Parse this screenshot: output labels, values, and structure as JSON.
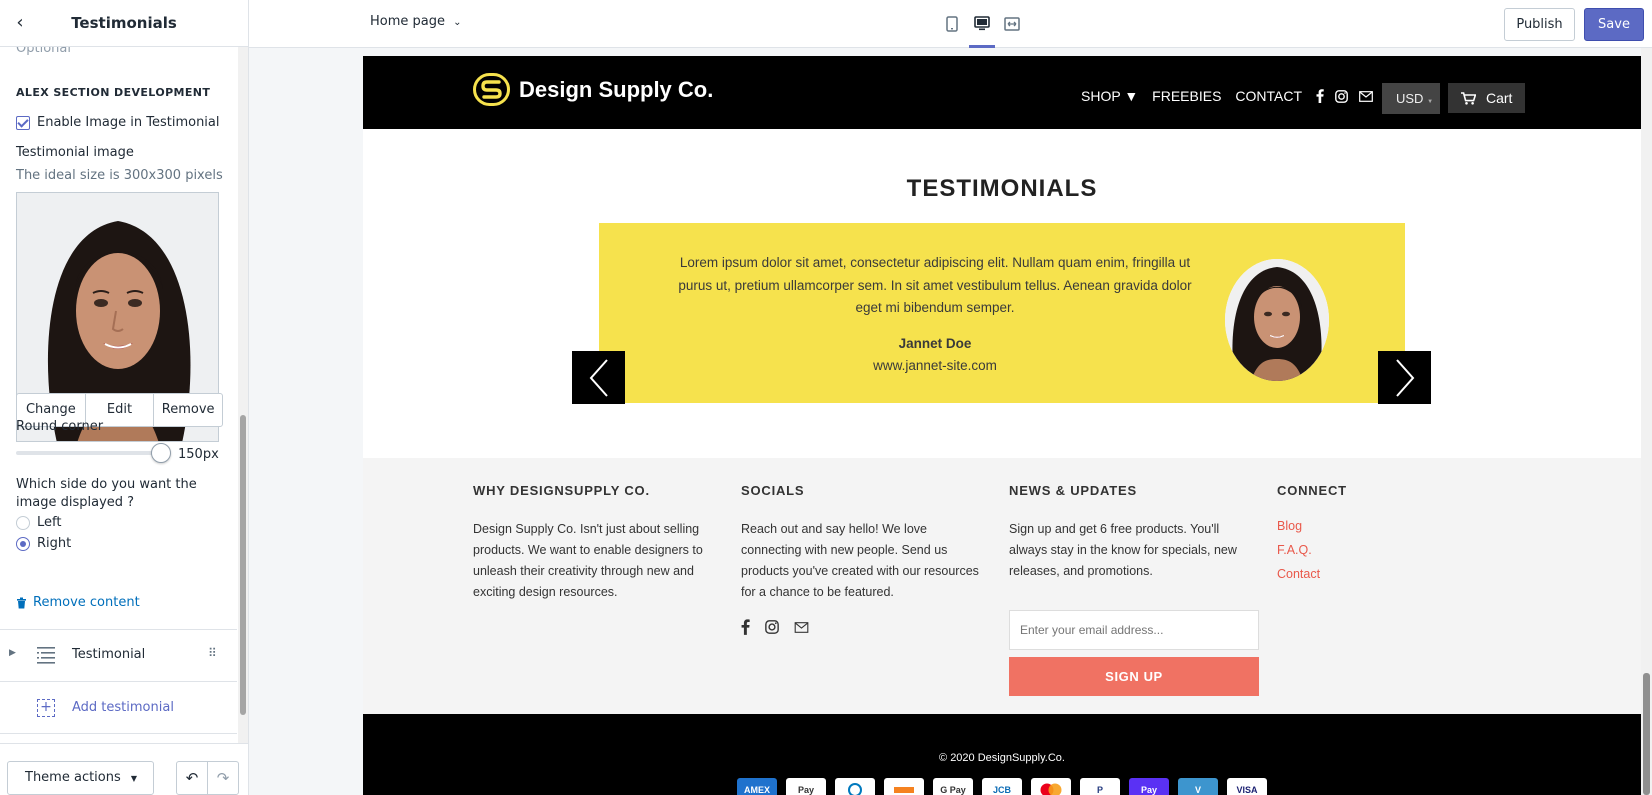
{
  "sidebar": {
    "title": "Testimonials",
    "optional_text": "Optional",
    "section_heading": "ALEX SECTION DEVELOPMENT",
    "enable_image_label": "Enable Image in Testimonial",
    "image_label": "Testimonial image",
    "image_hint": "The ideal size is 300x300 pixels",
    "image_buttons": {
      "change": "Change",
      "edit": "Edit",
      "remove": "Remove"
    },
    "round_corner_label": "Round corner",
    "round_corner_value": "150px",
    "side_question": "Which side do you want the image displayed ?",
    "side_options": [
      "Left",
      "Right"
    ],
    "side_selected": "Right",
    "remove_content": "Remove content",
    "block_item": "Testimonial",
    "add_block": "Add testimonial",
    "theme_actions": "Theme actions"
  },
  "topbar": {
    "page_select": "Home page",
    "publish": "Publish",
    "save": "Save"
  },
  "store": {
    "logo_text": "Design Supply Co.",
    "nav": [
      "SHOP ▼",
      "FREEBIES",
      "CONTACT"
    ],
    "currency": "USD",
    "cart": "Cart"
  },
  "testimonials": {
    "title": "TESTIMONIALS",
    "quote": "Lorem ipsum dolor sit amet, consectetur adipiscing elit. Nullam quam enim, fringilla ut purus ut, pretium ullamcorper sem. In sit amet vestibulum tellus. Aenean gravida dolor eget mi bibendum semper.",
    "name": "Jannet Doe",
    "site": "www.jannet-site.com"
  },
  "footer": {
    "why": {
      "heading": "WHY DESIGNSUPPLY CO.",
      "text": "Design Supply Co. Isn't just about selling products. We want to enable designers to unleash their creativity through new and exciting design resources."
    },
    "socials": {
      "heading": "SOCIALS",
      "text": "Reach out and say hello! We love connecting with new people. Send us products you've created with our resources for a chance to be featured."
    },
    "news": {
      "heading": "NEWS & UPDATES",
      "text": "Sign up and get 6 free products. You'll always stay in the know for specials, new releases, and promotions.",
      "email_placeholder": "Enter your email address...",
      "signup": "SIGN UP"
    },
    "connect": {
      "heading": "CONNECT",
      "links": [
        "Blog",
        "F.A.Q.",
        "Contact"
      ]
    },
    "copyright": "© 2020 DesignSupply.Co.",
    "payments": [
      "AMEX",
      "Pay",
      "",
      "",
      "G Pay",
      "JCB",
      "",
      "PayPal",
      "Pay",
      "V",
      "VISA"
    ]
  },
  "colors": {
    "accent": "#5c6ac4",
    "testimonial_bg": "#f6e24d",
    "signup_bg": "#f07263",
    "link": "#e9584a"
  }
}
